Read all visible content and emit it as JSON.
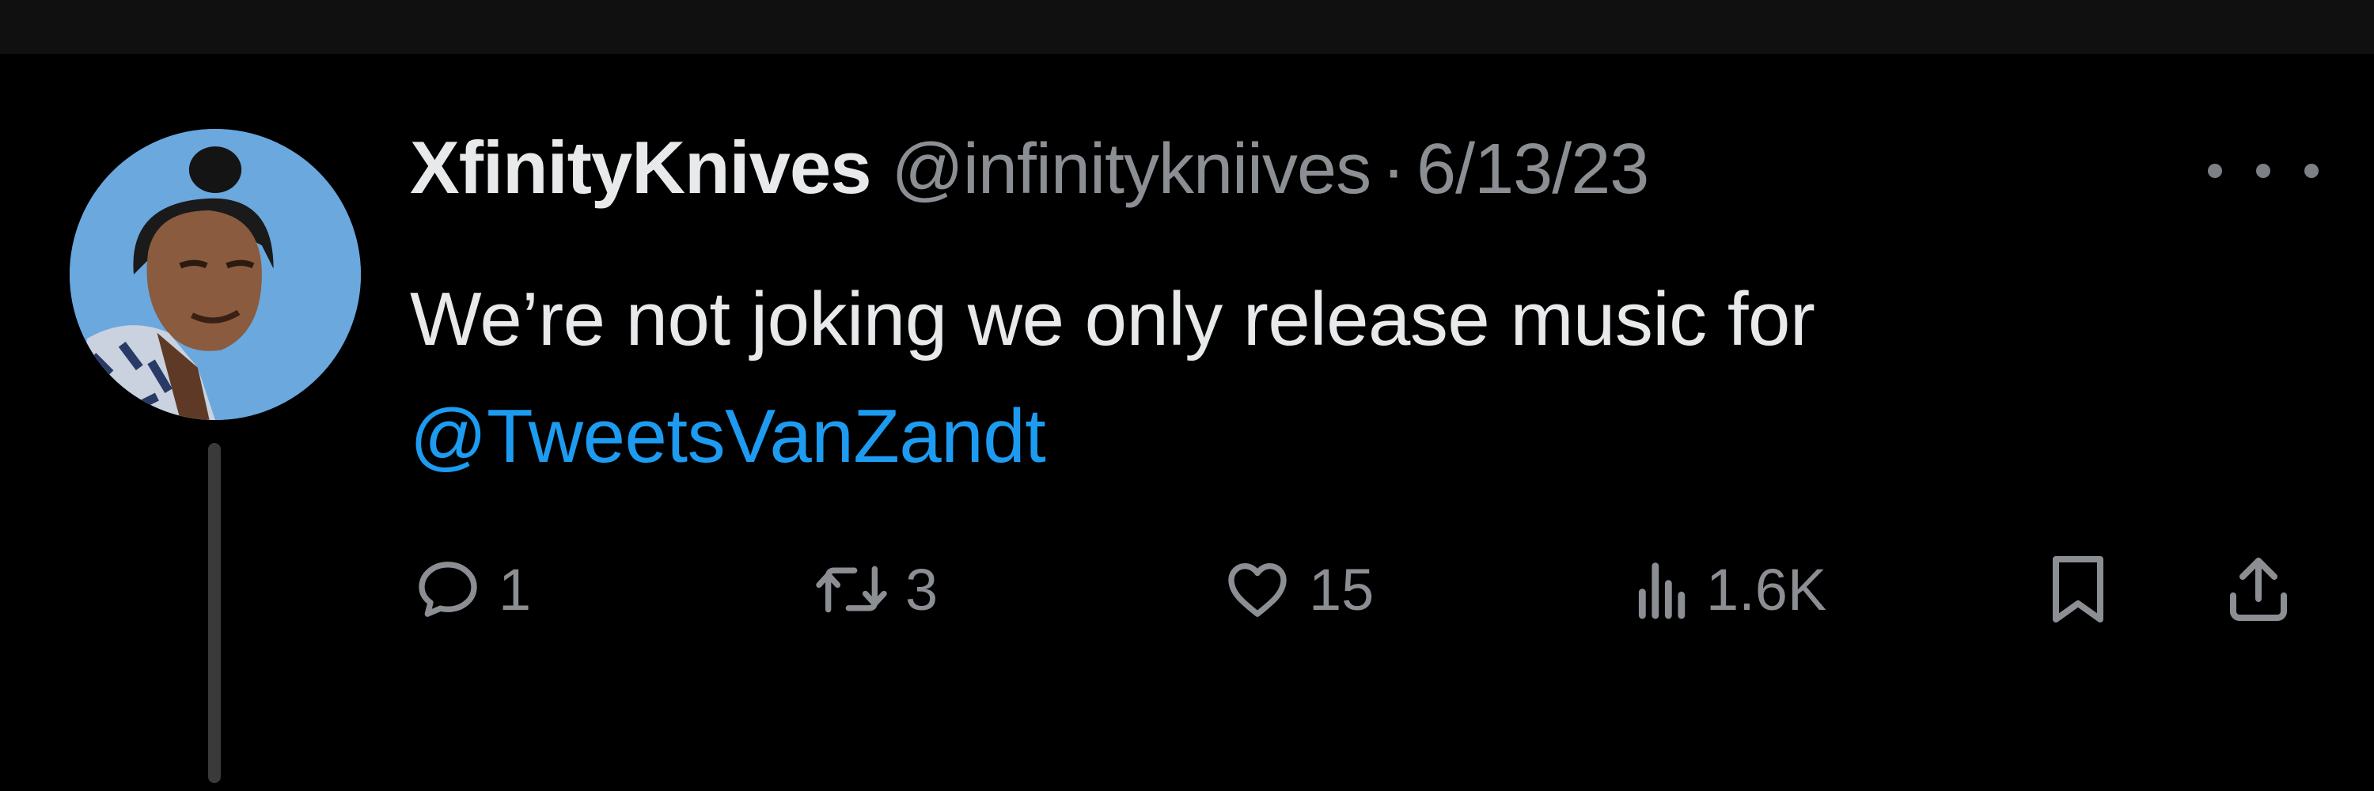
{
  "tweet": {
    "display_name": "XfinityKnives",
    "handle": "@infinitykniives",
    "separator": "·",
    "date": "6/13/23",
    "text_before": "We’re not joking we only release music for",
    "mention": "@TweetsVanZandt"
  },
  "actions": {
    "reply_count": "1",
    "retweet_count": "3",
    "like_count": "15",
    "view_count": "1.6K"
  },
  "icons": {
    "reply": "reply-icon",
    "retweet": "retweet-icon",
    "like": "heart-icon",
    "views": "views-icon",
    "bookmark": "bookmark-icon",
    "share": "share-icon",
    "more": "more-icon"
  },
  "colors": {
    "background": "#000000",
    "text": "#e7e9ea",
    "muted": "#8b8e93",
    "accent": "#1d9bf0"
  }
}
